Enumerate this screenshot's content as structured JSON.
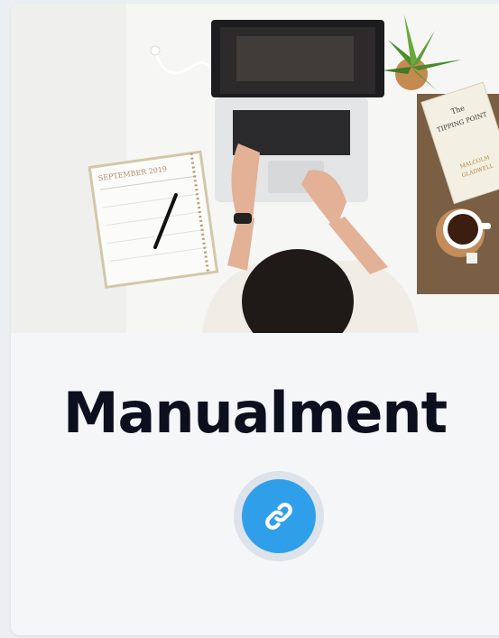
{
  "card": {
    "title": "Manualment",
    "photo": {
      "calendar_heading": "SEPTEMBER 2019",
      "book_cover_lines": [
        "The",
        "TIPPING POINT",
        "MALCOLM",
        "GLADWELL"
      ]
    },
    "link_icon": "link-icon"
  },
  "colors": {
    "button": "#2f9fea",
    "ring": "#dde3ea",
    "title": "#0b0f1e"
  }
}
